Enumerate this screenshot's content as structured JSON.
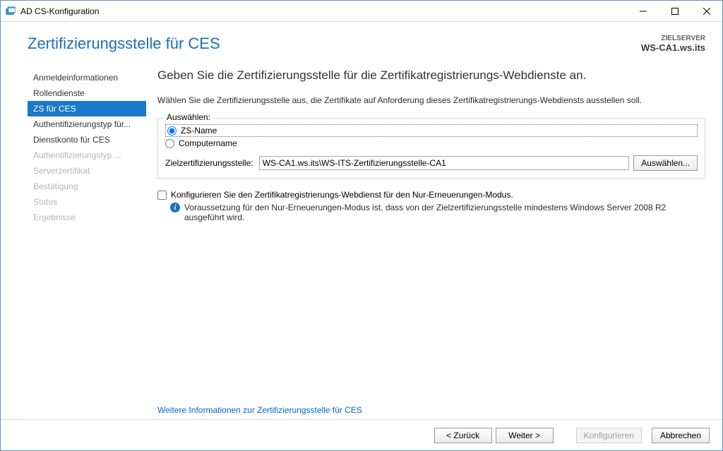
{
  "window": {
    "title": "AD CS-Konfiguration"
  },
  "header": {
    "page_title": "Zertifizierungsstelle für CES",
    "server_label": "ZIELSERVER",
    "server_value": "WS-CA1.ws.its"
  },
  "sidebar": {
    "items": [
      {
        "label": "Anmeldeinformationen",
        "state": "normal"
      },
      {
        "label": "Rollendienste",
        "state": "normal"
      },
      {
        "label": "ZS für CES",
        "state": "selected"
      },
      {
        "label": "Authentifizierungstyp für...",
        "state": "normal"
      },
      {
        "label": "Dienstkonto für CES",
        "state": "normal"
      },
      {
        "label": "Authentifizierungstyp ...",
        "state": "disabled"
      },
      {
        "label": "Serverzertifikat",
        "state": "disabled"
      },
      {
        "label": "Bestätigung",
        "state": "disabled"
      },
      {
        "label": "Status",
        "state": "disabled"
      },
      {
        "label": "Ergebnisse",
        "state": "disabled"
      }
    ]
  },
  "main": {
    "heading": "Geben Sie die Zertifizierungsstelle für die Zertifikatregistrierungs-Webdienste an.",
    "description": "Wählen Sie die Zertifizierungsstelle aus, die Zertifikate auf Anforderung dieses Zertifikatregistrierungs-Webdiensts ausstellen soll.",
    "group_title": "Auswählen:",
    "radio_zs": "ZS-Name",
    "radio_computer": "Computername",
    "target_label": "Zielzertifizierungsstelle:",
    "target_value": "WS-CA1.ws.its\\WS-ITS-Zertifizierungsstelle-CA1",
    "select_button": "Auswählen...",
    "checkbox_label": "Konfigurieren Sie den Zertifikatregistrierungs-Webdienst für den Nur-Erneuerungen-Modus.",
    "info_text": "Voraussetzung für den Nur-Erneuerungen-Modus ist, dass von der Zielzertifizierungsstelle mindestens Windows Server 2008 R2 ausgeführt wird.",
    "more_link": "Weitere Informationen zur Zertifizierungsstelle für CES"
  },
  "footer": {
    "previous": "< Zurück",
    "next": "Weiter >",
    "configure": "Konfigurieren",
    "cancel": "Abbrechen"
  }
}
